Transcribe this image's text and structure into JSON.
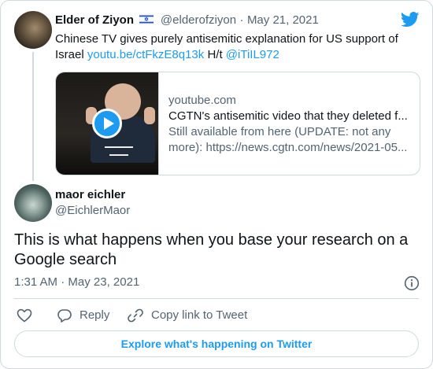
{
  "colors": {
    "accent": "#1d9bf0",
    "text": "#0f1419",
    "muted": "#536471",
    "border": "#cfd9de"
  },
  "quoted_tweet": {
    "author_name": "Elder of Ziyon",
    "flag_icon": "israel-flag-icon",
    "handle": "@elderofziyon",
    "separator": "·",
    "date": "May 21, 2021",
    "text_part1": "Chinese TV gives purely antisemitic explanation for US support of Israel",
    "link_text": "youtu.be/ctFkzE8q13k",
    "text_mid": "H/t",
    "mention": "@iTiIL972",
    "embed": {
      "domain": "youtube.com",
      "title": "CGTN's antisemitic video that they deleted f...",
      "description": "Still available from here (UPDATE: not any more): https://news.cgtn.com/news/2021-05..."
    }
  },
  "main_tweet": {
    "author_name": "maor eichler",
    "handle": "@EichlerMaor",
    "text": "This is what happens when you base your research on a Google search",
    "time": "1:31 AM",
    "separator": "·",
    "date": "May 23, 2021"
  },
  "actions": {
    "reply_label": "Reply",
    "copy_label": "Copy link to Tweet"
  },
  "footer": {
    "explore_label": "Explore what's happening on Twitter"
  }
}
